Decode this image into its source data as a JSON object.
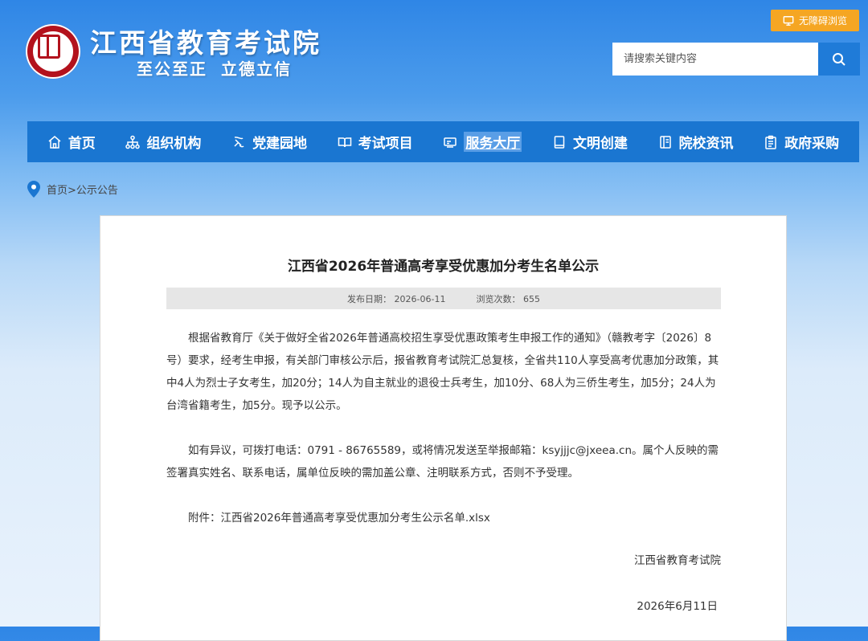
{
  "header": {
    "site_title": "江西省教育考试院",
    "slogan": "至公至正  立德立信",
    "accessibility_label": "无障碍浏览",
    "search_placeholder": "请搜索关键内容"
  },
  "nav": {
    "items": [
      {
        "label": "首页",
        "icon": "home-icon"
      },
      {
        "label": "组织机构",
        "icon": "org-chart-icon"
      },
      {
        "label": "党建园地",
        "icon": "party-icon"
      },
      {
        "label": "考试项目",
        "icon": "book-open-icon"
      },
      {
        "label": "服务大厅",
        "icon": "service-icon"
      },
      {
        "label": "文明创建",
        "icon": "notebook-icon"
      },
      {
        "label": "院校资讯",
        "icon": "document-icon"
      },
      {
        "label": "政府采购",
        "icon": "clipboard-icon"
      }
    ],
    "active_index": 4
  },
  "breadcrumb": {
    "home": "首页",
    "separator": ">",
    "current": "公示公告"
  },
  "article": {
    "title": "江西省2026年普通高考享受优惠加分考生名单公示",
    "publish_date": "发布日期：  2026-06-11",
    "views": "浏览次数：  655",
    "paragraphs": [
      "根据省教育厅《关于做好全省2026年普通高校招生享受优惠政策考生申报工作的通知》（赣教考字〔2026〕8号）要求，经考生申报，有关部门审核公示后，报省教育考试院汇总复核，全省共110人享受高考优惠加分政策，其中4人为烈士子女考生，加20分；14人为自主就业的退役士兵考生，加10分、68人为三侨生考生，加5分；24人为台湾省籍考生，加5分。现予以公示。",
      "如有异议，可拨打电话：0791 - 86765589，或将情况发送至举报邮箱：ksyjjjc@jxeea.cn。属个人反映的需签署真实姓名、联系电话，属单位反映的需加盖公章、注明联系方式，否则不予受理。",
      "附件：江西省2026年普通高考享受优惠加分考生公示名单.xlsx"
    ],
    "signature_org": "江西省教育考试院",
    "signature_date": "2026年6月11日"
  },
  "colors": {
    "nav_bg": "#1a76d1",
    "accessibility_btn": "#f5a623",
    "search_btn": "#1f7bd8",
    "logo_red": "#b3121d"
  }
}
